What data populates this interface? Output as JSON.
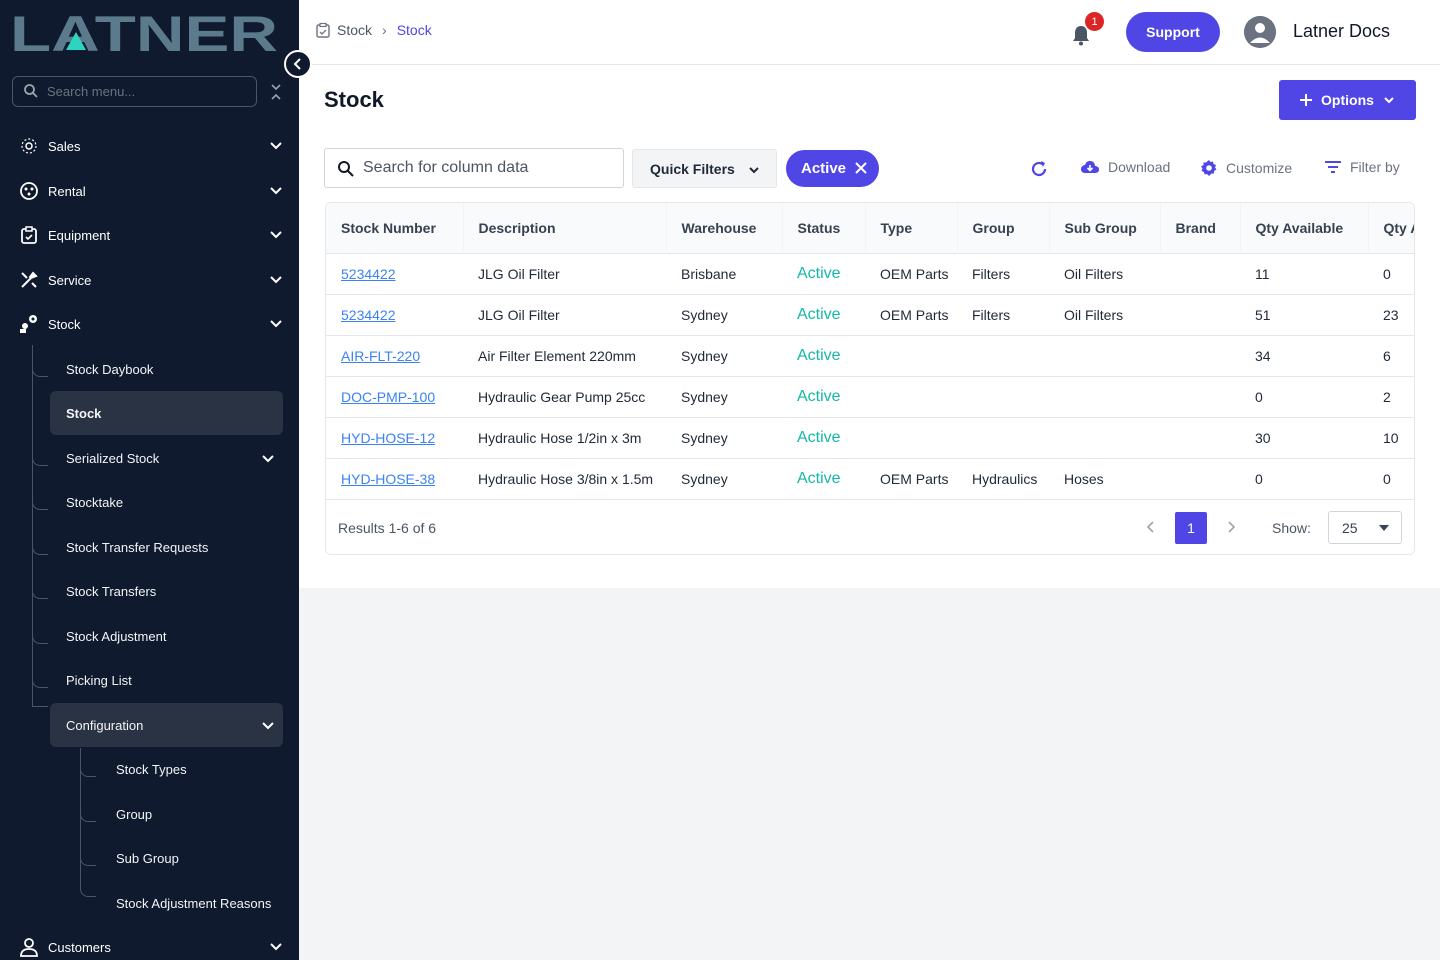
{
  "brand": {
    "logo_text": "LATNER",
    "logo_color": "#5b7a8c",
    "accent_color": "#4f46e5"
  },
  "sidebar": {
    "search_placeholder": "Search menu...",
    "items": [
      {
        "label": "Sales",
        "icon": "sales-icon"
      },
      {
        "label": "Rental",
        "icon": "rental-icon"
      },
      {
        "label": "Equipment",
        "icon": "equipment-icon"
      },
      {
        "label": "Service",
        "icon": "service-icon"
      },
      {
        "label": "Stock",
        "icon": "stock-icon"
      }
    ],
    "stock_children": [
      {
        "label": "Stock Daybook"
      },
      {
        "label": "Stock",
        "active": true
      },
      {
        "label": "Serialized Stock",
        "expandable": true
      },
      {
        "label": "Stocktake"
      },
      {
        "label": "Stock Transfer Requests"
      },
      {
        "label": "Stock Transfers"
      },
      {
        "label": "Stock Adjustment"
      },
      {
        "label": "Picking List"
      },
      {
        "label": "Configuration",
        "expandable": true
      }
    ],
    "config_children": [
      {
        "label": "Stock Types"
      },
      {
        "label": "Group"
      },
      {
        "label": "Sub Group"
      },
      {
        "label": "Stock Adjustment Reasons"
      }
    ],
    "customers": {
      "label": "Customers",
      "icon": "customers-icon"
    }
  },
  "topbar": {
    "breadcrumb": [
      "Stock",
      "Stock"
    ],
    "notification_count": "1",
    "support_label": "Support",
    "user_name": "Latner Docs"
  },
  "page": {
    "title": "Stock",
    "options_label": "Options",
    "search_placeholder": "Search for column data",
    "quick_filters_label": "Quick Filters",
    "active_filter_chip": "Active",
    "tools": {
      "download": "Download",
      "customize": "Customize",
      "filter_by": "Filter by"
    }
  },
  "table": {
    "columns": [
      "Stock Number",
      "Description",
      "Warehouse",
      "Status",
      "Type",
      "Group",
      "Sub Group",
      "Brand",
      "Qty Available",
      "Qty A"
    ],
    "rows": [
      [
        "5234422",
        "JLG Oil Filter",
        "Brisbane",
        "Active",
        "OEM Parts",
        "Filters",
        "Oil Filters",
        "",
        "11",
        "0"
      ],
      [
        "5234422",
        "JLG Oil Filter",
        "Sydney",
        "Active",
        "OEM Parts",
        "Filters",
        "Oil Filters",
        "",
        "51",
        "23"
      ],
      [
        "AIR-FLT-220",
        "Air Filter Element 220mm",
        "Sydney",
        "Active",
        "",
        "",
        "",
        "",
        "34",
        "6"
      ],
      [
        "DOC-PMP-100",
        "Hydraulic Gear Pump 25cc",
        "Sydney",
        "Active",
        "",
        "",
        "",
        "",
        "0",
        "2"
      ],
      [
        "HYD-HOSE-12",
        "Hydraulic Hose 1/2in x 3m",
        "Sydney",
        "Active",
        "",
        "",
        "",
        "",
        "30",
        "10"
      ],
      [
        "HYD-HOSE-38",
        "Hydraulic Hose 3/8in x 1.5m",
        "Sydney",
        "Active",
        "OEM Parts",
        "Hydraulics",
        "Hoses",
        "",
        "0",
        "0"
      ]
    ],
    "results_text": "Results 1-6 of 6",
    "current_page": "1",
    "show_label": "Show:",
    "page_size": "25"
  }
}
